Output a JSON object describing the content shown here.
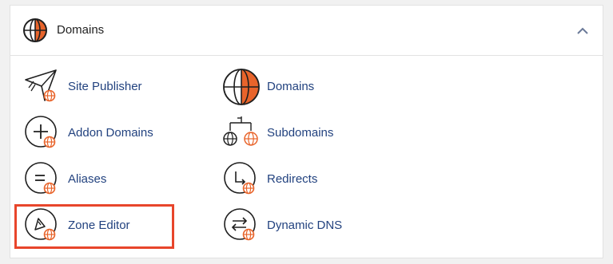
{
  "panel": {
    "title": "Domains",
    "header_icon": "globe-icon",
    "collapse_icon": "chevron-up-icon"
  },
  "tools": {
    "site_publisher": {
      "label": "Site Publisher",
      "icon": "paper-plane-icon"
    },
    "addon_domains": {
      "label": "Addon Domains",
      "icon": "plus-icon"
    },
    "aliases": {
      "label": "Aliases",
      "icon": "equals-icon"
    },
    "zone_editor": {
      "label": "Zone Editor",
      "icon": "zone-editor-icon"
    },
    "domains": {
      "label": "Domains",
      "icon": "globe-icon"
    },
    "subdomains": {
      "label": "Subdomains",
      "icon": "subdomains-tree-icon"
    },
    "redirects": {
      "label": "Redirects",
      "icon": "redirect-arrow-icon"
    },
    "dynamic_dns": {
      "label": "Dynamic DNS",
      "icon": "swap-arrows-icon"
    }
  },
  "colors": {
    "accent_orange": "#e8642b",
    "highlight_red": "#e8452b",
    "link_blue": "#22427f"
  }
}
